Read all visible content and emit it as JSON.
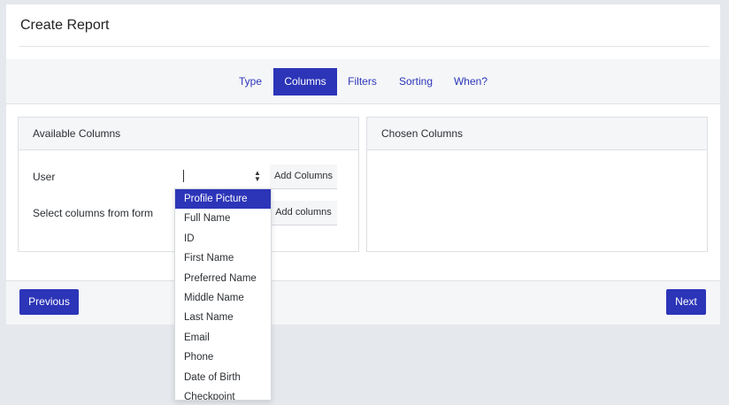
{
  "page": {
    "title": "Create Report"
  },
  "tabs": [
    {
      "label": "Type"
    },
    {
      "label": "Columns"
    },
    {
      "label": "Filters"
    },
    {
      "label": "Sorting"
    },
    {
      "label": "When?"
    }
  ],
  "active_tab": "Columns",
  "available": {
    "header": "Available Columns",
    "user_label": "User",
    "user_select_value": "",
    "add_columns_label": "Add Columns",
    "form_label": "Select columns from form",
    "add_columns_form_label": "Add columns"
  },
  "chosen": {
    "header": "Chosen Columns"
  },
  "dropdown": {
    "options": [
      "Profile Picture",
      "Full Name",
      "ID",
      "First Name",
      "Preferred Name",
      "Middle Name",
      "Last Name",
      "Email",
      "Phone",
      "Date of Birth",
      "Checkpoint"
    ],
    "highlighted": "Profile Picture"
  },
  "footer": {
    "previous_label": "Previous",
    "next_label": "Next"
  },
  "colors": {
    "accent": "#2c35b8",
    "background": "#e5e8ec",
    "panel_header": "#f5f6f8"
  },
  "icons": {
    "select_arrows": "updown-arrows-icon"
  }
}
